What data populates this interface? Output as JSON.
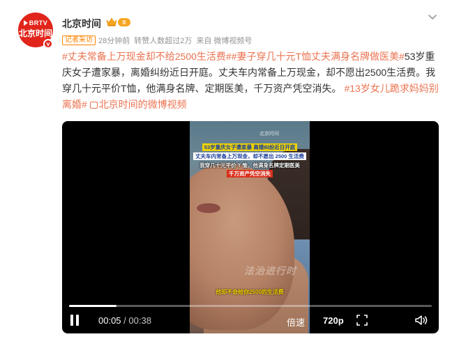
{
  "author": {
    "name": "北京时间",
    "avatar_top_text": "BRTV",
    "avatar_bottom_text": "北京时间",
    "verified_mark": "v",
    "level_badge": "II"
  },
  "meta": {
    "tag": "记者采访",
    "time": "28分钟前",
    "reposts": "转赞人数超过2万",
    "source": "来自 微博视频号"
  },
  "post": {
    "topic1": "#丈夫常备上万现金却不给2500生活费#",
    "topic2": "#妻子穿几十元T恤丈夫满身名牌做医美#",
    "body": "53岁重庆女子遭家暴，离婚纠纷近日开庭。丈夫车内常备上万现金，却不愿出2500生活费。我穿几十元平价T恤，他满身名牌、定期医美，千万资产凭空消失。",
    "topic3": "#13岁女儿跪求妈妈别离婚#",
    "video_link": "北京时间的微博视频"
  },
  "video": {
    "caption_line1": "53岁重庆女子遭家暴 离婚纠纷近日开庭",
    "caption_line2": "丈夫车内常备上万现金，却不愿出 2500 生活费",
    "caption_line3": "我穿几十元平价 T 恤，他满身名牌定期医美",
    "caption_line4": "千万资产凭空消失",
    "watermark": "北京时间",
    "watermark2": "法治进行时",
    "subtitle": "他却不会给你2500的生活费",
    "current_time": "00:05",
    "duration": "00:38",
    "progress": 0.131,
    "speed_label": "倍速",
    "quality_label": "720p"
  },
  "colors": {
    "topic": "#eb7350",
    "brand_red": "#e1251b",
    "tag_orange": "#ff8200"
  },
  "icons": [
    "more-icon",
    "vip-crown-icon",
    "video-link-icon",
    "pause-icon",
    "fullscreen-icon",
    "volume-icon"
  ]
}
